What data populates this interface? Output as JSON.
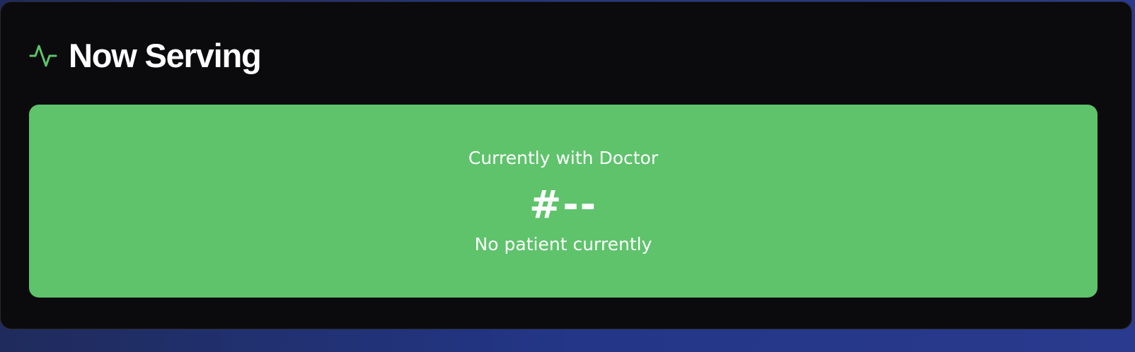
{
  "now_serving": {
    "title": "Now Serving",
    "icon": "activity-pulse-icon",
    "current_label": "Currently with Doctor",
    "current_number": "#--",
    "status_text": "No patient currently"
  },
  "colors": {
    "accent": "#5ec36b",
    "panel_background": "#0b0b0e",
    "page_background": "#233687",
    "text": "#ffffff"
  }
}
